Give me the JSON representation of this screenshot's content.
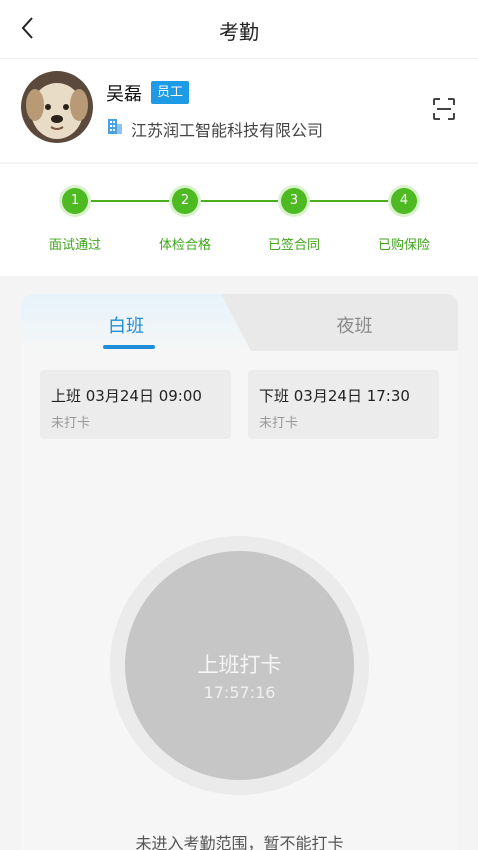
{
  "header": {
    "title": "考勤"
  },
  "profile": {
    "name": "吴磊",
    "role_badge": "员工",
    "company": "江苏润工智能科技有限公司"
  },
  "steps": [
    {
      "number": "1",
      "label": "面试通过"
    },
    {
      "number": "2",
      "label": "体检合格"
    },
    {
      "number": "3",
      "label": "已签合同"
    },
    {
      "number": "4",
      "label": "已购保险"
    }
  ],
  "tabs": {
    "day": "白班",
    "night": "夜班",
    "active": "day"
  },
  "shifts": {
    "start": {
      "time": "上班 03月24日 09:00",
      "status": "未打卡"
    },
    "end": {
      "time": "下班 03月24日 17:30",
      "status": "未打卡"
    }
  },
  "punch": {
    "label": "上班打卡",
    "clock": "17:57:16"
  },
  "range_note": "未进入考勤范围，暂不能打卡",
  "colors": {
    "accent": "#1e8fd8",
    "badge": "#1e9be6",
    "step_green": "#4cba20"
  }
}
